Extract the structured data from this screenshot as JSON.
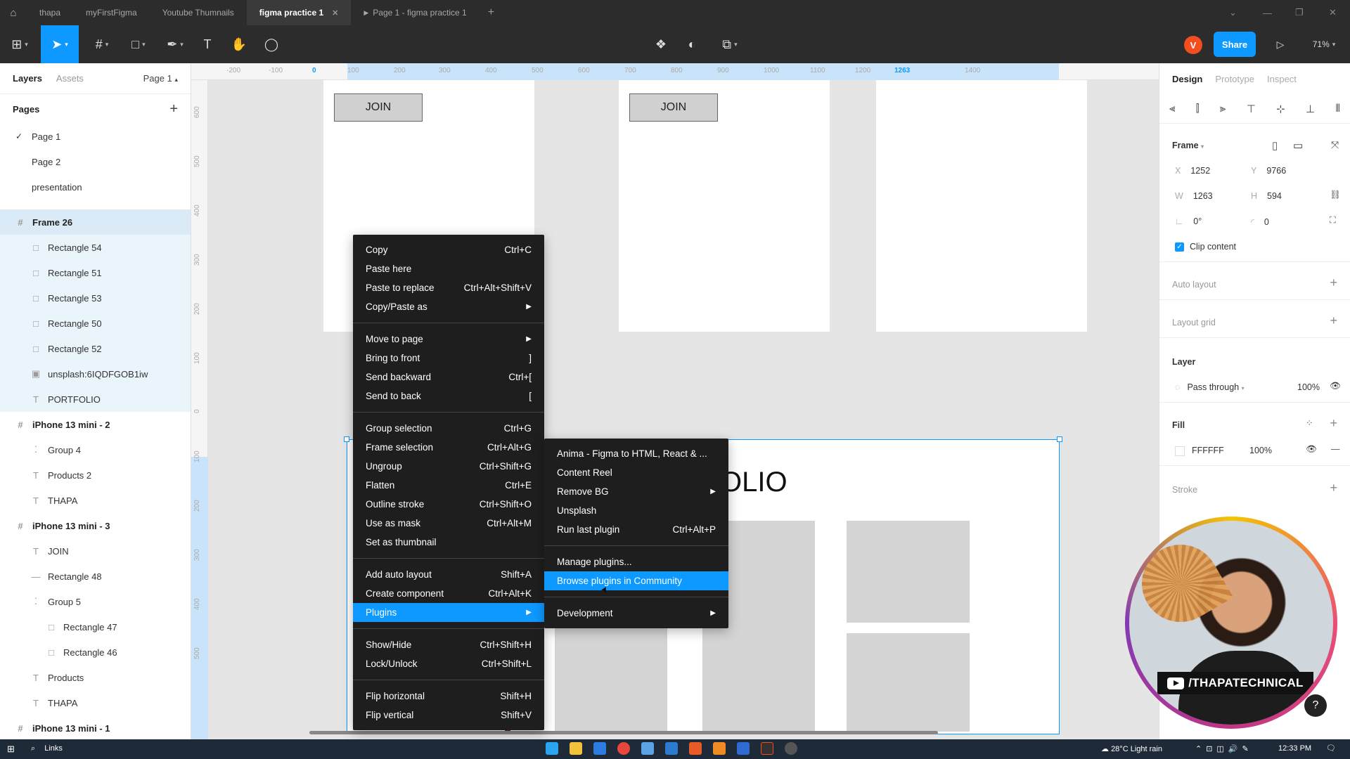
{
  "tabs": [
    {
      "label": "thapa"
    },
    {
      "label": "myFirstFigma"
    },
    {
      "label": "Youtube Thumnails"
    },
    {
      "label": "figma practice 1",
      "active": true
    },
    {
      "label": "Page 1 - figma practice 1"
    }
  ],
  "toolbar": {
    "avatar_letter": "V",
    "share_label": "Share",
    "zoom": "71%"
  },
  "left_panel": {
    "tab_layers": "Layers",
    "tab_assets": "Assets",
    "current_page": "Page 1",
    "pages_header": "Pages",
    "pages": [
      "Page 1",
      "Page 2",
      "presentation"
    ],
    "layers": [
      {
        "label": "Frame 26",
        "kind": "frame"
      },
      {
        "label": "Rectangle 54",
        "kind": "rect"
      },
      {
        "label": "Rectangle 51",
        "kind": "rect"
      },
      {
        "label": "Rectangle 53",
        "kind": "rect"
      },
      {
        "label": "Rectangle 50",
        "kind": "rect"
      },
      {
        "label": "Rectangle 52",
        "kind": "rect"
      },
      {
        "label": "unsplash:6IQDFGOB1iw",
        "kind": "image"
      },
      {
        "label": "PORTFOLIO",
        "kind": "text"
      },
      {
        "label": "iPhone 13 mini - 2",
        "kind": "frame"
      },
      {
        "label": "Group 4",
        "kind": "group"
      },
      {
        "label": "Products 2",
        "kind": "text"
      },
      {
        "label": "THAPA",
        "kind": "text"
      },
      {
        "label": "iPhone 13 mini - 3",
        "kind": "frame"
      },
      {
        "label": "JOIN",
        "kind": "text"
      },
      {
        "label": "Rectangle 48",
        "kind": "line"
      },
      {
        "label": "Group 5",
        "kind": "group"
      },
      {
        "label": "Rectangle 47",
        "kind": "rect"
      },
      {
        "label": "Rectangle 46",
        "kind": "rect"
      },
      {
        "label": "Products",
        "kind": "text"
      },
      {
        "label": "THAPA",
        "kind": "text"
      },
      {
        "label": "iPhone 13 mini - 1",
        "kind": "frame"
      }
    ]
  },
  "canvas": {
    "ruler_top": [
      "-200",
      "-100",
      "0",
      "100",
      "200",
      "300",
      "400",
      "500",
      "600",
      "700",
      "800",
      "900",
      "1000",
      "1100",
      "1200",
      "1263",
      "1400"
    ],
    "ruler_left": [
      "600",
      "500",
      "400",
      "300",
      "200",
      "100",
      "0",
      "100",
      "200",
      "300",
      "400",
      "500"
    ],
    "join_label": "JOIN",
    "heading_fragment": "OLIO"
  },
  "context_menu": {
    "groups": [
      [
        {
          "label": "Copy",
          "shortcut": "Ctrl+C"
        },
        {
          "label": "Paste here",
          "shortcut": ""
        },
        {
          "label": "Paste to replace",
          "shortcut": "Ctrl+Alt+Shift+V"
        },
        {
          "label": "Copy/Paste as",
          "submenu": true
        }
      ],
      [
        {
          "label": "Move to page",
          "submenu": true
        },
        {
          "label": "Bring to front",
          "shortcut": "]"
        },
        {
          "label": "Send backward",
          "shortcut": "Ctrl+["
        },
        {
          "label": "Send to back",
          "shortcut": "["
        }
      ],
      [
        {
          "label": "Group selection",
          "shortcut": "Ctrl+G"
        },
        {
          "label": "Frame selection",
          "shortcut": "Ctrl+Alt+G"
        },
        {
          "label": "Ungroup",
          "shortcut": "Ctrl+Shift+G"
        },
        {
          "label": "Flatten",
          "shortcut": "Ctrl+E"
        },
        {
          "label": "Outline stroke",
          "shortcut": "Ctrl+Shift+O"
        },
        {
          "label": "Use as mask",
          "shortcut": "Ctrl+Alt+M"
        },
        {
          "label": "Set as thumbnail",
          "shortcut": ""
        }
      ],
      [
        {
          "label": "Add auto layout",
          "shortcut": "Shift+A"
        },
        {
          "label": "Create component",
          "shortcut": "Ctrl+Alt+K"
        },
        {
          "label": "Plugins",
          "submenu": true,
          "highlighted": true
        }
      ],
      [
        {
          "label": "Show/Hide",
          "shortcut": "Ctrl+Shift+H"
        },
        {
          "label": "Lock/Unlock",
          "shortcut": "Ctrl+Shift+L"
        }
      ],
      [
        {
          "label": "Flip horizontal",
          "shortcut": "Shift+H"
        },
        {
          "label": "Flip vertical",
          "shortcut": "Shift+V"
        }
      ]
    ]
  },
  "plugins_menu": {
    "groups": [
      [
        {
          "label": "Anima - Figma to HTML, React & ...",
          "shortcut": ""
        },
        {
          "label": "Content Reel",
          "shortcut": ""
        },
        {
          "label": "Remove BG",
          "submenu": true
        },
        {
          "label": "Unsplash",
          "shortcut": ""
        },
        {
          "label": "Run last plugin",
          "shortcut": "Ctrl+Alt+P"
        }
      ],
      [
        {
          "label": "Manage plugins...",
          "shortcut": ""
        },
        {
          "label": "Browse plugins in Community",
          "highlighted": true
        }
      ],
      [
        {
          "label": "Development",
          "submenu": true
        }
      ]
    ]
  },
  "right_panel": {
    "tab_design": "Design",
    "tab_prototype": "Prototype",
    "tab_inspect": "Inspect",
    "frame_label": "Frame",
    "x": "1252",
    "y": "9766",
    "w": "1263",
    "h": "594",
    "rotation": "0°",
    "radius": "0",
    "clip_content": "Clip content",
    "auto_layout": "Auto layout",
    "layout_grid": "Layout grid",
    "layer": "Layer",
    "blend": "Pass through",
    "opacity": "100%",
    "fill": "Fill",
    "fill_hex": "FFFFFF",
    "fill_opacity": "100%",
    "stroke": "Stroke"
  },
  "webcam": {
    "handle": "/THAPATECHNICAL"
  },
  "taskbar": {
    "search": "Links",
    "weather": "28°C  Light rain",
    "time": "12:33 PM"
  },
  "colors": {
    "accent": "#0d99ff",
    "dark_chrome": "#2c2c2c",
    "menu_bg": "#1e1e1e",
    "avatar": "#f24e1e"
  }
}
